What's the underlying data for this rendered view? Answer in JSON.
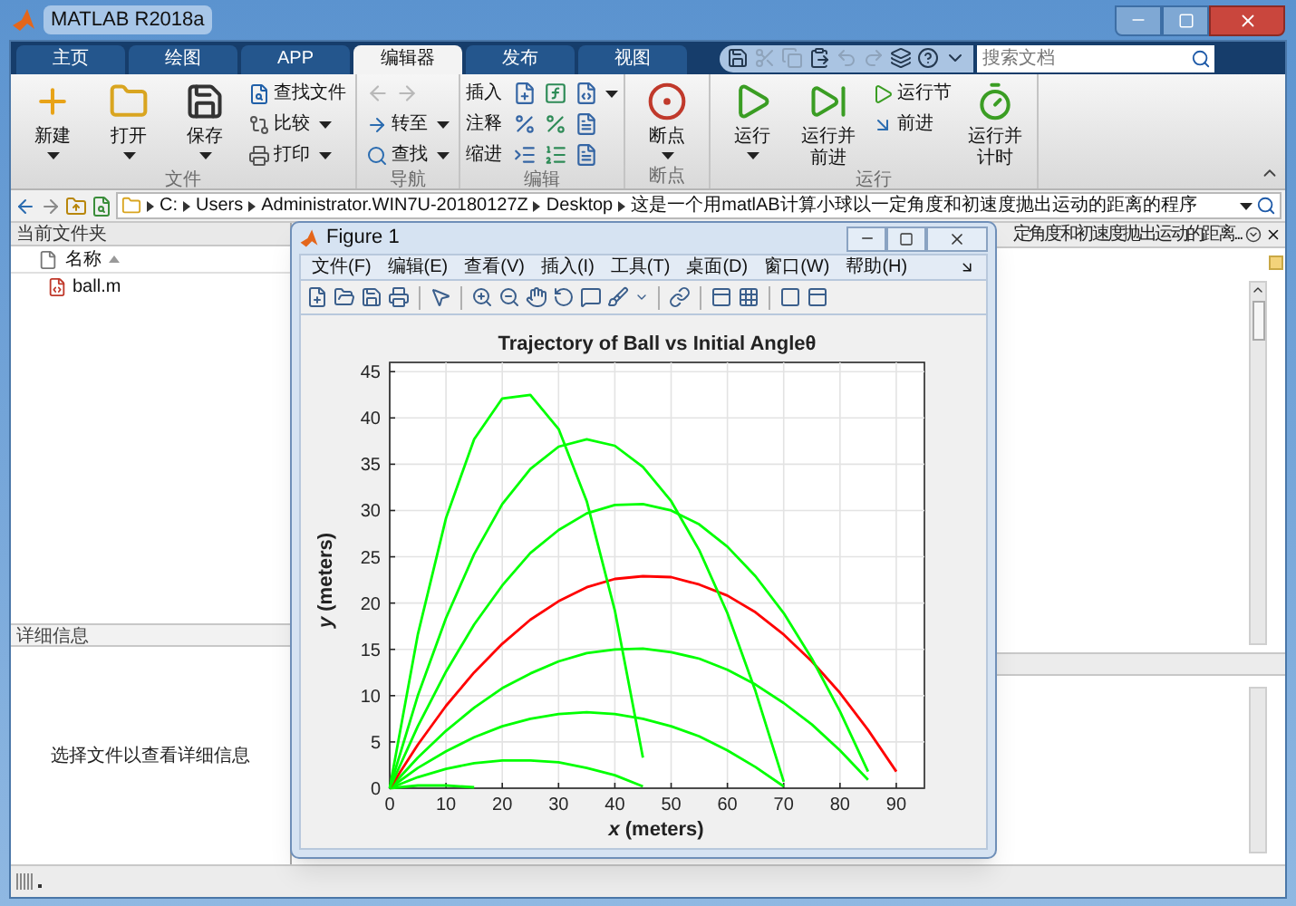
{
  "window": {
    "title": "MATLAB R2018a"
  },
  "tabs": [
    {
      "label": "主页",
      "selected": false
    },
    {
      "label": "绘图",
      "selected": false
    },
    {
      "label": "APP",
      "selected": false
    },
    {
      "label": "编辑器",
      "selected": true
    },
    {
      "label": "发布",
      "selected": false
    },
    {
      "label": "视图",
      "selected": false
    }
  ],
  "quick_access": [
    {
      "kind": "save",
      "disabled": false
    },
    {
      "kind": "cut",
      "disabled": true
    },
    {
      "kind": "copy",
      "disabled": true
    },
    {
      "kind": "paste",
      "disabled": false
    },
    {
      "kind": "undo",
      "disabled": true
    },
    {
      "kind": "redo",
      "disabled": true
    },
    {
      "kind": "windows",
      "disabled": false
    },
    {
      "kind": "help",
      "disabled": false
    },
    {
      "kind": "more",
      "disabled": false
    }
  ],
  "search": {
    "placeholder": "搜索文档"
  },
  "ribbon": {
    "groups": [
      {
        "label": "文件",
        "columns": [
          [
            {
              "kind": "large",
              "label": "新建",
              "caret": true
            }
          ],
          [
            {
              "kind": "large",
              "label": "打开",
              "caret": true
            }
          ],
          [
            {
              "kind": "large",
              "label": "保存",
              "caret": true
            }
          ],
          [
            {
              "kind": "small",
              "label": "查找文件",
              "caret": false
            },
            {
              "kind": "small",
              "label": "比较",
              "caret": true
            },
            {
              "kind": "small",
              "label": "打印",
              "caret": true
            }
          ]
        ]
      },
      {
        "label": "导航",
        "columns": [
          [
            {
              "kind": "arrows",
              "disabled": true
            },
            {
              "kind": "small",
              "label": "转至",
              "caret": true
            },
            {
              "kind": "small",
              "label": "查找",
              "caret": true
            }
          ]
        ]
      },
      {
        "label": "编辑",
        "columns": [
          [
            {
              "kind": "row",
              "label": "插入",
              "caret": true
            },
            {
              "kind": "row",
              "label": "注释",
              "caret": false
            },
            {
              "kind": "row",
              "label": "缩进",
              "caret": false
            }
          ]
        ]
      },
      {
        "label": "断点",
        "columns": [
          [
            {
              "kind": "large",
              "label": "断点",
              "caret": true
            }
          ]
        ]
      },
      {
        "label": "运行",
        "columns": [
          [
            {
              "kind": "large",
              "label": "运行",
              "caret": true
            }
          ],
          [
            {
              "kind": "large",
              "label": "运行并前进",
              "caret": false
            }
          ],
          [
            {
              "kind": "small",
              "label": "运行节",
              "caret": false
            },
            {
              "kind": "small",
              "label": "前进",
              "caret": false
            }
          ],
          [
            {
              "kind": "large",
              "label": "运行并计时",
              "caret": false
            }
          ]
        ]
      }
    ]
  },
  "address_bar": {
    "segments": [
      "C:",
      "Users",
      "Administrator.WIN7U-20180127Z",
      "Desktop",
      "这是一个用matlAB计算小球以一定角度和初速度抛出运动的距离的程序"
    ]
  },
  "current_folder": {
    "title": "当前文件夹",
    "column": "名称",
    "files": [
      "ball.m"
    ]
  },
  "details": {
    "title": "详细信息",
    "message": "选择文件以查看详细信息"
  },
  "editor": {
    "tab_title": "定角度和初速度抛出运动的距离..."
  },
  "figure": {
    "title": "Figure 1",
    "menu": [
      "文件(F)",
      "编辑(E)",
      "查看(V)",
      "插入(I)",
      "工具(T)",
      "桌面(D)",
      "窗口(W)",
      "帮助(H)"
    ],
    "chart_data": {
      "type": "line",
      "grid": true,
      "title": "Trajectory of Ball vs Initial Angleθ",
      "xlabel": "*x* (meters)",
      "ylabel": "*y* (meters)",
      "x": [
        0,
        5,
        10,
        15,
        20,
        25,
        30,
        35,
        40,
        45,
        50,
        55,
        60,
        65,
        70,
        75,
        80,
        85,
        90
      ],
      "series": [
        {
          "color": "#00ff00",
          "values": [
            0,
            0.3,
            0.3,
            0.1,
            null,
            null,
            null,
            null,
            null,
            null,
            null,
            null,
            null,
            null,
            null,
            null,
            null,
            null,
            null
          ]
        },
        {
          "color": "#00ff00",
          "values": [
            0,
            1.2,
            2.1,
            2.7,
            3,
            3,
            2.8,
            2.2,
            1.4,
            0.2,
            null,
            null,
            null,
            null,
            null,
            null,
            null,
            null,
            null
          ]
        },
        {
          "color": "#00ff00",
          "values": [
            0,
            2.2,
            4,
            5.5,
            6.7,
            7.5,
            8,
            8.2,
            8,
            7.5,
            6.7,
            5.6,
            4.1,
            2.3,
            0.2,
            null,
            null,
            null,
            null
          ]
        },
        {
          "color": "#00ff00",
          "values": [
            0,
            3.3,
            6.2,
            8.7,
            10.8,
            12.4,
            13.7,
            14.6,
            15,
            15.1,
            14.7,
            14,
            12.8,
            11.2,
            9.2,
            6.9,
            4.1,
            0.9,
            null
          ]
        },
        {
          "color": "#ff0000",
          "values": [
            0,
            4.7,
            8.9,
            12.5,
            15.6,
            18.2,
            20.2,
            21.7,
            22.6,
            22.9,
            22.8,
            22,
            20.8,
            19,
            16.6,
            13.7,
            10.3,
            6.3,
            1.8
          ]
        },
        {
          "color": "#00ff00",
          "values": [
            0,
            6.7,
            12.6,
            17.7,
            21.9,
            25.4,
            27.9,
            29.7,
            30.6,
            30.7,
            30,
            28.5,
            26.1,
            22.9,
            18.9,
            14,
            8.3,
            1.8,
            null
          ]
        },
        {
          "color": "#00ff00",
          "values": [
            0,
            10,
            18.4,
            25.3,
            30.7,
            34.5,
            36.9,
            37.7,
            37,
            34.7,
            31,
            25.7,
            18.9,
            10.5,
            0.7,
            null,
            null,
            null,
            null
          ]
        },
        {
          "color": "#00ff00",
          "values": [
            0,
            16.6,
            29.2,
            37.7,
            42.1,
            42.5,
            38.8,
            31,
            19.2,
            3.3,
            null,
            null,
            null,
            null,
            null,
            null,
            null,
            null,
            null
          ]
        }
      ],
      "xlim": [
        0,
        95
      ],
      "ylim": [
        0,
        46
      ],
      "xticks": [
        0,
        10,
        20,
        30,
        40,
        50,
        60,
        70,
        80,
        90
      ],
      "yticks": [
        0,
        5,
        10,
        15,
        20,
        25,
        30,
        35,
        40,
        45
      ]
    }
  }
}
